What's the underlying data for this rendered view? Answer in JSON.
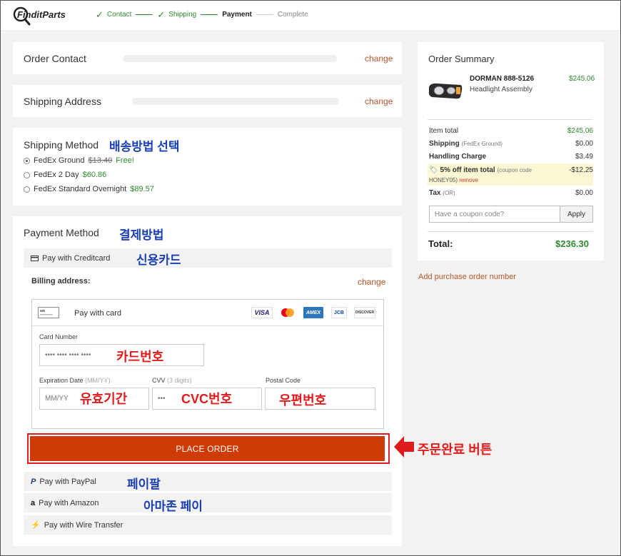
{
  "header": {
    "logo_text": "FinditParts",
    "steps": [
      {
        "label": "Contact",
        "state": "done"
      },
      {
        "label": "Shipping",
        "state": "done"
      },
      {
        "label": "Payment",
        "state": "current"
      },
      {
        "label": "Complete",
        "state": "todo"
      }
    ]
  },
  "contact": {
    "title": "Order Contact",
    "change": "change"
  },
  "shipping_address": {
    "title": "Shipping Address",
    "change": "change"
  },
  "shipping_method": {
    "title": "Shipping Method",
    "annotation": "배송방법 선택",
    "options": [
      {
        "name": "FedEx Ground",
        "old_price": "$13.40",
        "price": "Free!",
        "selected": true
      },
      {
        "name": "FedEx 2 Day",
        "price": "$60.86",
        "selected": false
      },
      {
        "name": "FedEx Standard Overnight",
        "price": "$89.57",
        "selected": false
      }
    ]
  },
  "payment": {
    "title": "Payment Method",
    "annotation": "결제방법",
    "creditcard_label": "Pay with Creditcard",
    "creditcard_annotation": "신용카드",
    "billing_label": "Billing address:",
    "billing_change": "change",
    "pay_with_card": "Pay with card",
    "card_logos": [
      "VISA",
      "mastercard",
      "AMEX",
      "JCB",
      "DISCOVER"
    ],
    "card_number_label": "Card Number",
    "card_number_placeholder": "•••• •••• •••• ••••",
    "card_number_annotation": "카드번호",
    "expiration_label": "Expiration Date",
    "expiration_hint": "(MM/YY)",
    "expiration_placeholder": "MM/YY",
    "expiration_annotation": "유효기간",
    "cvv_label": "CVV",
    "cvv_hint": "(3 digits)",
    "cvv_placeholder": "•••",
    "cvv_annotation": "CVC번호",
    "postal_label": "Postal Code",
    "postal_annotation": "우편번호",
    "place_order": "PLACE ORDER",
    "place_order_annotation": "주문완료 버튼",
    "paypal_label": "Pay with PayPal",
    "paypal_annotation": "페이팔",
    "amazon_label": "Pay with Amazon",
    "amazon_annotation": "아마존 페이",
    "wire_label": "Pay with Wire Transfer"
  },
  "summary": {
    "title": "Order Summary",
    "product_name": "DORMAN 888-5126",
    "product_desc": "Headlight Assembly",
    "product_price": "$245.06",
    "item_total_label": "Item total",
    "item_total": "$245.06",
    "shipping_label": "Shipping",
    "shipping_note": "(FedEx Ground)",
    "shipping": "$0.00",
    "handling_label": "Handling Charge",
    "handling": "$3.49",
    "discount_label": "5% off item total",
    "discount_note": "(coupon code",
    "discount_code": "HONEY05)",
    "discount_remove": "remove",
    "discount": "-$12.25",
    "tax_label": "Tax",
    "tax_note": "(OR)",
    "tax": "$0.00",
    "coupon_placeholder": "Have a coupon code?",
    "apply": "Apply",
    "total_label": "Total:",
    "total": "$236.30",
    "po_link": "Add purchase order number"
  },
  "colors": {
    "accent": "#d03a07",
    "link": "#b5542a",
    "green": "#2e8b2e",
    "annotation_blue": "#1a3fb5",
    "annotation_red": "#e01b1b"
  }
}
